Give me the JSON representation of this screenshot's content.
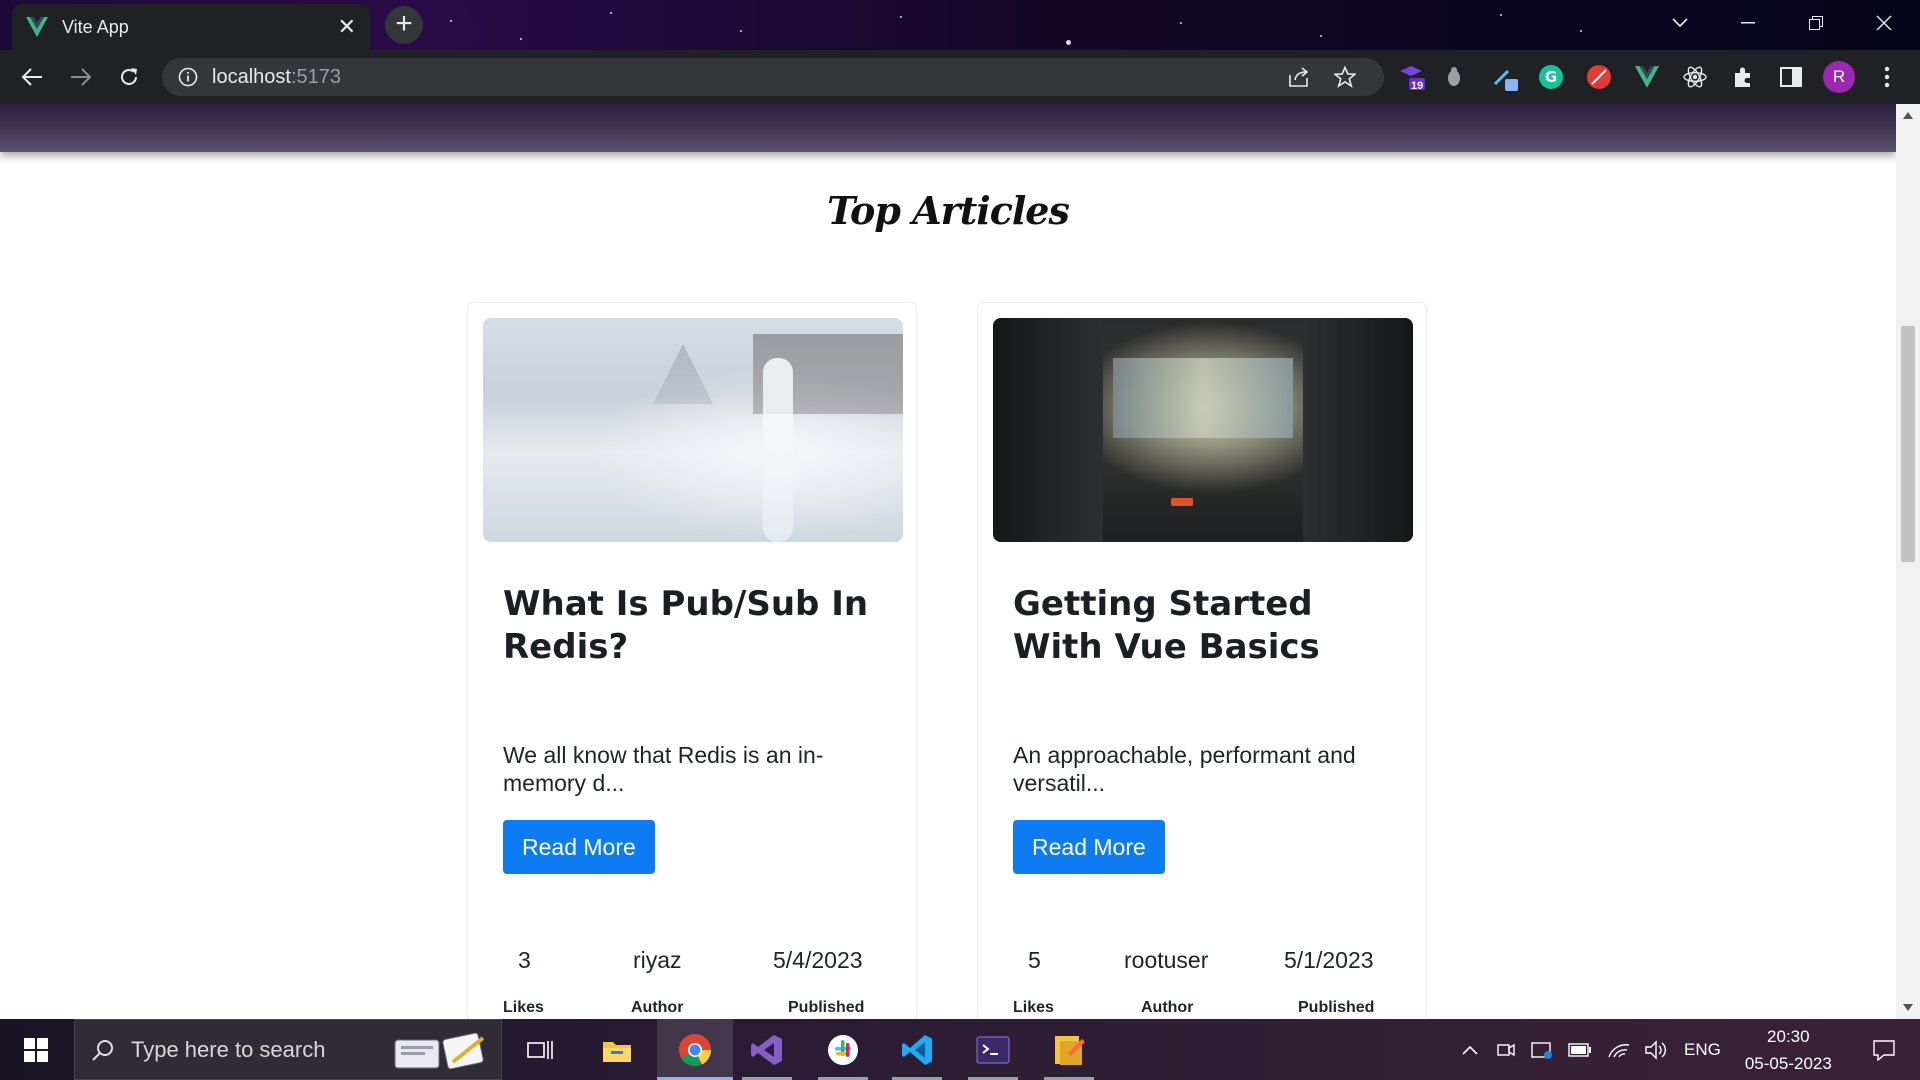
{
  "browser": {
    "tab_title": "Vite App",
    "tab_close": "✕",
    "new_tab": "+",
    "url_host": "localhost",
    "url_port": ":5173",
    "profile_initial": "R",
    "extension_badge": "19"
  },
  "page": {
    "section_title": "Top Articles",
    "articles": [
      {
        "title": "What Is Pub/Sub In Redis?",
        "excerpt": "We all know that Redis is an in-memory d...",
        "button_label": "Read More",
        "likes": "3",
        "author": "riyaz",
        "published": "5/4/2023",
        "likes_label": "Likes",
        "author_label": "Author",
        "published_label": "Published"
      },
      {
        "title": "Getting Started With Vue Basics",
        "excerpt": "An approachable, performant and versatil...",
        "button_label": "Read More",
        "likes": "5",
        "author": "rootuser",
        "published": "5/1/2023",
        "likes_label": "Likes",
        "author_label": "Author",
        "published_label": "Published"
      }
    ]
  },
  "taskbar": {
    "search_placeholder": "Type here to search",
    "language": "ENG",
    "time": "20:30",
    "date": "05-05-2023"
  },
  "colors": {
    "accent": "#0d7cf2",
    "chrome_bg": "#202124"
  }
}
